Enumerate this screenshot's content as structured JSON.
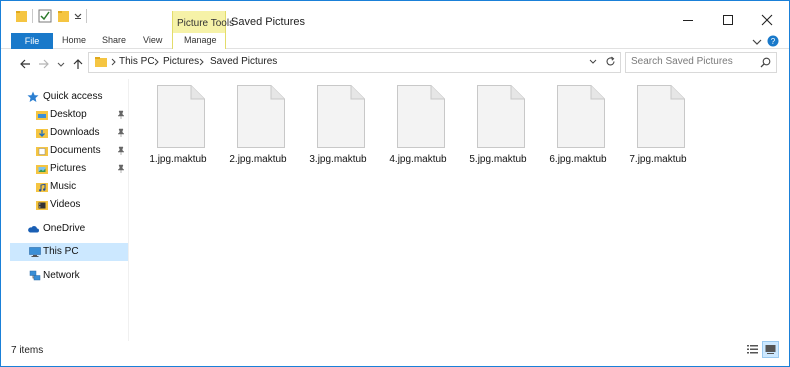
{
  "window": {
    "title": "Saved Pictures",
    "context_tab_group": "Picture Tools"
  },
  "ribbon": {
    "tabs": [
      {
        "label": "File"
      },
      {
        "label": "Home"
      },
      {
        "label": "Share"
      },
      {
        "label": "View"
      },
      {
        "label": "Manage"
      }
    ]
  },
  "address": {
    "breadcrumbs": [
      "This PC",
      "Pictures",
      "Saved Pictures"
    ]
  },
  "search": {
    "placeholder": "Search Saved Pictures"
  },
  "navigation": {
    "items": [
      {
        "label": "Quick access",
        "icon": "star-icon",
        "pinned": false
      },
      {
        "label": "Desktop",
        "icon": "desktop-folder-icon",
        "pinned": true
      },
      {
        "label": "Downloads",
        "icon": "downloads-folder-icon",
        "pinned": true
      },
      {
        "label": "Documents",
        "icon": "documents-folder-icon",
        "pinned": true
      },
      {
        "label": "Pictures",
        "icon": "pictures-folder-icon",
        "pinned": true
      },
      {
        "label": "Music",
        "icon": "music-folder-icon",
        "pinned": false
      },
      {
        "label": "Videos",
        "icon": "videos-folder-icon",
        "pinned": false
      },
      {
        "label": "OneDrive",
        "icon": "onedrive-cloud-icon",
        "pinned": false
      },
      {
        "label": "This PC",
        "icon": "computer-icon",
        "pinned": false,
        "selected": true
      },
      {
        "label": "Network",
        "icon": "network-icon",
        "pinned": false
      }
    ]
  },
  "files": [
    {
      "name": "1.jpg.maktub"
    },
    {
      "name": "2.jpg.maktub"
    },
    {
      "name": "3.jpg.maktub"
    },
    {
      "name": "4.jpg.maktub"
    },
    {
      "name": "5.jpg.maktub"
    },
    {
      "name": "6.jpg.maktub"
    },
    {
      "name": "7.jpg.maktub"
    }
  ],
  "status": {
    "item_count": "7 items"
  },
  "colors": {
    "accent": "#1979ca",
    "selection": "#cce8ff",
    "picture_tools": "#f6f2a8",
    "folder": "#f5c542"
  }
}
